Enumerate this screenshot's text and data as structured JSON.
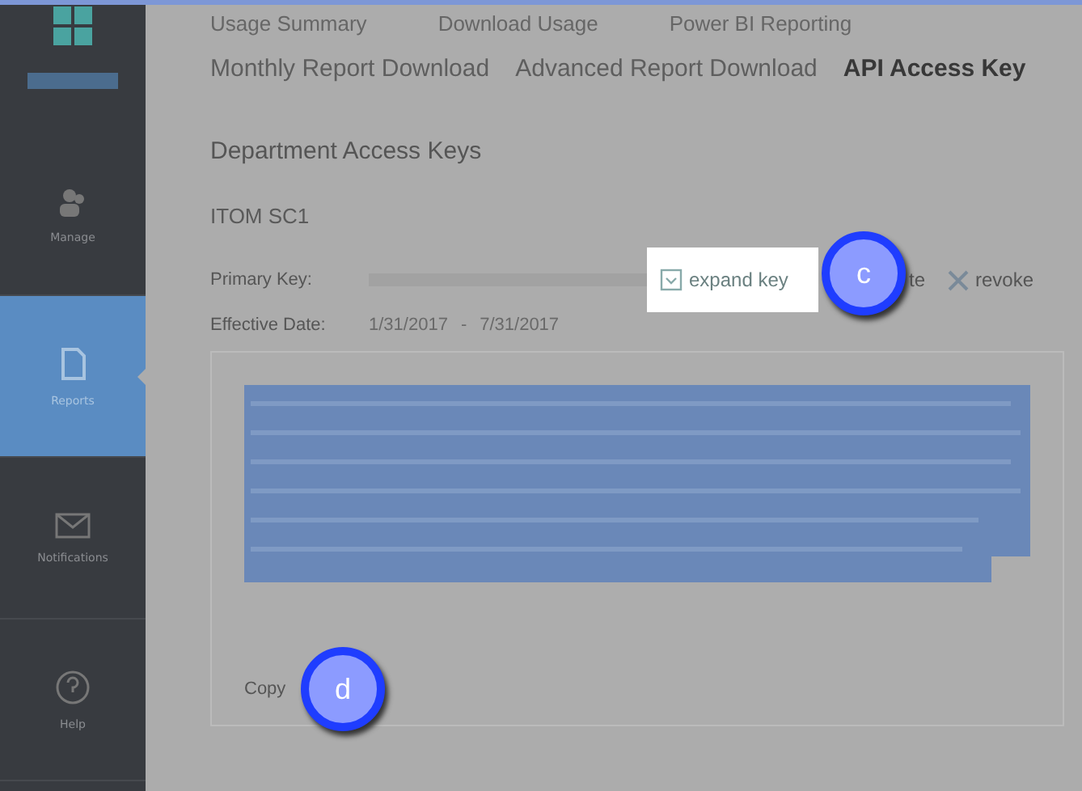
{
  "sidebar": {
    "items": [
      {
        "label": "Manage",
        "selected": false
      },
      {
        "label": "Reports",
        "selected": true
      },
      {
        "label": "Notifications",
        "selected": false
      },
      {
        "label": "Help",
        "selected": false
      }
    ]
  },
  "tabs_top": [
    {
      "label": "Usage Summary"
    },
    {
      "label": "Download Usage"
    },
    {
      "label": "Power BI Reporting"
    }
  ],
  "tabs": [
    {
      "label": "Monthly Report Download",
      "selected": false
    },
    {
      "label": "Advanced Report Download",
      "selected": false
    },
    {
      "label": "API Access Key",
      "selected": true
    }
  ],
  "heading": "Department Access Keys",
  "department": "ITOM SC1",
  "primary_key": {
    "label": "Primary Key:",
    "expand": "expand key",
    "partial_action": "te",
    "revoke": "revoke"
  },
  "effective": {
    "label": "Effective Date:",
    "start": "1/31/2017",
    "separator": "-",
    "end": "7/31/2017"
  },
  "copy": "Copy",
  "callouts": [
    {
      "label": "c"
    },
    {
      "label": "d"
    }
  ]
}
